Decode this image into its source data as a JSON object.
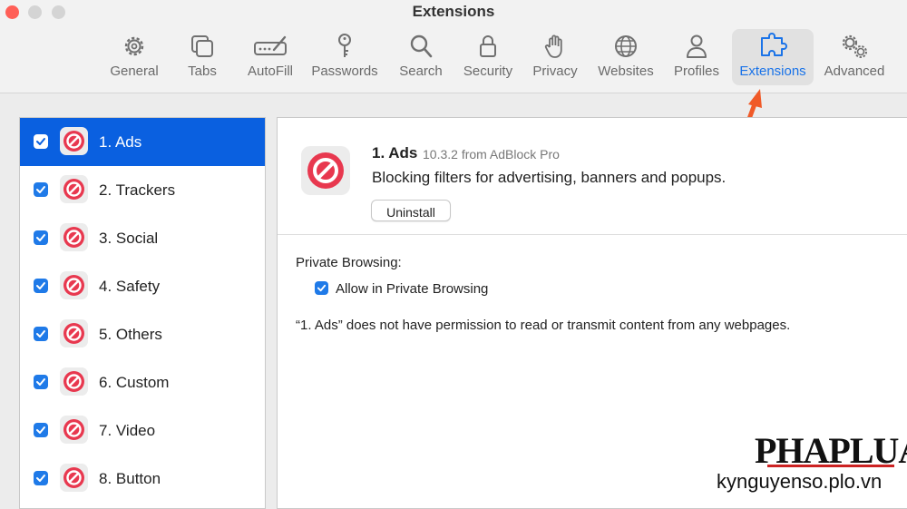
{
  "window": {
    "title": "Extensions"
  },
  "toolbar": {
    "items": [
      {
        "label": "General",
        "icon": "gear-icon"
      },
      {
        "label": "Tabs",
        "icon": "tabs-icon"
      },
      {
        "label": "AutoFill",
        "icon": "pencil-field-icon"
      },
      {
        "label": "Passwords",
        "icon": "key-icon"
      },
      {
        "label": "Search",
        "icon": "search-icon"
      },
      {
        "label": "Security",
        "icon": "lock-icon"
      },
      {
        "label": "Privacy",
        "icon": "hand-icon"
      },
      {
        "label": "Websites",
        "icon": "globe-icon"
      },
      {
        "label": "Profiles",
        "icon": "person-icon"
      },
      {
        "label": "Extensions",
        "icon": "puzzle-icon"
      },
      {
        "label": "Advanced",
        "icon": "gears-icon"
      }
    ],
    "active": "Extensions"
  },
  "sidebar": {
    "items": [
      {
        "label": "1. Ads",
        "checked": true,
        "selected": true
      },
      {
        "label": "2. Trackers",
        "checked": true
      },
      {
        "label": "3. Social",
        "checked": true
      },
      {
        "label": "4. Safety",
        "checked": true
      },
      {
        "label": "5. Others",
        "checked": true
      },
      {
        "label": "6. Custom",
        "checked": true
      },
      {
        "label": "7. Video",
        "checked": true
      },
      {
        "label": "8. Button",
        "checked": true
      }
    ]
  },
  "detail": {
    "name": "1. Ads",
    "version": "10.3.2 from AdBlock Pro",
    "description": "Blocking filters for advertising, banners and popups.",
    "uninstall_label": "Uninstall",
    "private_browsing_label": "Private Browsing:",
    "allow_private_label": "Allow in Private Browsing",
    "allow_private_checked": true,
    "permission_text": "“1. Ads” does not have permission to read or transmit content from any webpages."
  },
  "watermark": {
    "brand": "PHAPLUAT",
    "url": "kynguyenso.plo.vn"
  },
  "colors": {
    "accent": "#0a60e0",
    "annotation_arrow": "#f05a28",
    "block_icon": "#e8384f"
  }
}
